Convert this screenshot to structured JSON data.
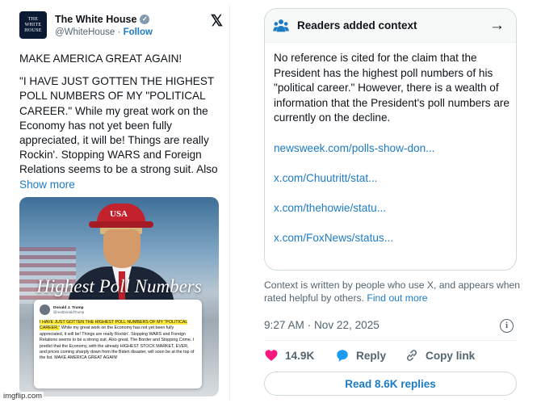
{
  "tweet": {
    "account_logo_text": "THE WHITE HOUSE",
    "account_name": "The White House",
    "handle": "@WhiteHouse",
    "separator": "·",
    "follow_label": "Follow",
    "text_line1": "MAKE AMERICA GREAT AGAIN!",
    "text_body": "\"I HAVE JUST GOTTEN THE HIGHEST POLL NUMBERS OF MY \"POLITICAL CAREER.\" While my great work on the Economy has not yet been fully appreciated, it will be! Things are really Rockin'. Stopping WARS and Foreign Relations seems to be a strong suit. Also",
    "show_more": "Show more",
    "media": {
      "hat_text": "USA",
      "headline": "Highest Poll Numbers",
      "card_name": "Donald J. Trump",
      "card_handle": "@realDonaldTrump",
      "card_highlight": "I HAVE JUST GOTTEN THE HIGHEST POLL NUMBERS OF MY \"POLITICAL CAREER.\"",
      "card_body": " While my great work on the Economy has not yet been fully appreciated, it will be! Things are really Rockin'. Stopping WARS and Foreign Relations seems to be a strong suit. Also great, The Border and Stopping Crime. I predict that the Economy, with the already HIGHEST STOCK MARKET, EVER, and prices coming sharply down from the Biden disaster, will soon be at the top of the list. MAKE AMERICA GREAT AGAIN!"
    }
  },
  "watermark": "imgflip.com",
  "context": {
    "title": "Readers added context",
    "body": "No reference is cited for the claim that the President has the highest poll numbers of his \"political career.\" However, there is a wealth of information that the President's poll numbers are currently on the decline.",
    "links": [
      "newsweek.com/polls-show-don...",
      "x.com/Chuutritt/stat...",
      "x.com/thehowie/statu...",
      "x.com/FoxNews/status..."
    ],
    "footer_text": "Context is written by people who use X, and appears when rated helpful by others.",
    "find_out_more": "Find out more"
  },
  "timestamp": "9:27 AM · Nov 22, 2025",
  "actions": {
    "likes": "14.9K",
    "reply_label": "Reply",
    "copy_link_label": "Copy link"
  },
  "read_replies": "Read 8.6K replies",
  "colors": {
    "link_blue": "#1d7bc4",
    "like_pink": "#f91880",
    "reply_blue": "#1d9bf0",
    "muted_gray": "#536471"
  }
}
